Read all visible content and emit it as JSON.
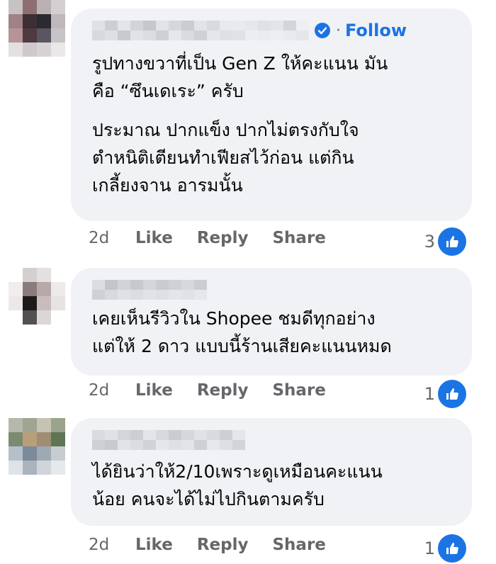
{
  "comments": [
    {
      "follow_label": "Follow",
      "separator": "·",
      "text_lines": [
        "รูปทางขวาที่เป็น Gen Z ให้คะแนน มัน",
        "คือ “ซึนเดเระ” ครับ",
        "ประมาณ ปากแข็ง ปากไม่ตรงกับใจ",
        "ตำหนิติเตียนทำเฟียสไว้ก่อน แต่กิน",
        "เกลี้ยงจาน อารมนั้น"
      ],
      "time": "2d",
      "like_label": "Like",
      "reply_label": "Reply",
      "share_label": "Share",
      "reaction_count": "3"
    },
    {
      "text_lines": [
        "เคยเห็นรีวิวใน Shopee ชมดีทุกอย่าง",
        "แต่ให้ 2 ดาว แบบนี้ร้านเสียคะแนนหมด"
      ],
      "time": "2d",
      "like_label": "Like",
      "reply_label": "Reply",
      "share_label": "Share",
      "reaction_count": "1"
    },
    {
      "text_lines": [
        "ได้ยินว่าให้2/10เพราะดูเหมือนคะแนน",
        "น้อย คนจะได้ไม่ไปกินตามครับ"
      ],
      "time": "2d",
      "like_label": "Like",
      "reply_label": "Reply",
      "share_label": "Share",
      "reaction_count": "1"
    }
  ],
  "icons": {
    "verified": "verified-badge-icon",
    "like": "thumbs-up-icon"
  },
  "colors": {
    "accent": "#1b74e4",
    "bubble": "#f0f2f5",
    "muted": "#65676b"
  }
}
